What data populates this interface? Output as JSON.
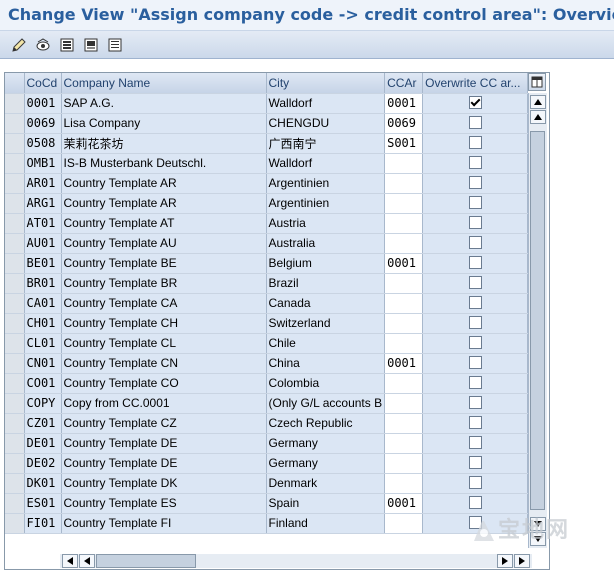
{
  "window": {
    "title": "Change View \"Assign company code -> credit control area\": Overview"
  },
  "toolbar": {
    "buttons": [
      "edit-icon",
      "display-change-icon",
      "select-all-icon",
      "select-block-icon",
      "deselect-all-icon"
    ]
  },
  "table": {
    "columns": [
      "CoCd",
      "Company Name",
      "City",
      "CCAr",
      "Overwrite CC ar..."
    ],
    "rows": [
      {
        "cocd": "0001",
        "name": "SAP A.G.",
        "city": "Walldorf",
        "ccar": "0001",
        "overwrite": true
      },
      {
        "cocd": "0069",
        "name": "Lisa Company",
        "city": "CHENGDU",
        "ccar": "0069",
        "overwrite": false
      },
      {
        "cocd": "0508",
        "name": "茉莉花茶坊",
        "city": "广西南宁",
        "ccar": "S001",
        "overwrite": false
      },
      {
        "cocd": "OMB1",
        "name": "IS-B Musterbank Deutschl.",
        "city": "Walldorf",
        "ccar": "",
        "overwrite": false
      },
      {
        "cocd": "AR01",
        "name": "Country Template AR",
        "city": "Argentinien",
        "ccar": "",
        "overwrite": false
      },
      {
        "cocd": "ARG1",
        "name": "Country Template AR",
        "city": "Argentinien",
        "ccar": "",
        "overwrite": false
      },
      {
        "cocd": "AT01",
        "name": "Country Template AT",
        "city": "Austria",
        "ccar": "",
        "overwrite": false
      },
      {
        "cocd": "AU01",
        "name": "Country Template AU",
        "city": "Australia",
        "ccar": "",
        "overwrite": false
      },
      {
        "cocd": "BE01",
        "name": "Country Template BE",
        "city": "Belgium",
        "ccar": "0001",
        "overwrite": false
      },
      {
        "cocd": "BR01",
        "name": "Country Template BR",
        "city": "Brazil",
        "ccar": "",
        "overwrite": false
      },
      {
        "cocd": "CA01",
        "name": "Country Template CA",
        "city": "Canada",
        "ccar": "",
        "overwrite": false
      },
      {
        "cocd": "CH01",
        "name": "Country Template CH",
        "city": "Switzerland",
        "ccar": "",
        "overwrite": false
      },
      {
        "cocd": "CL01",
        "name": "Country Template CL",
        "city": "Chile",
        "ccar": "",
        "overwrite": false
      },
      {
        "cocd": "CN01",
        "name": "Country Template CN",
        "city": "China",
        "ccar": "0001",
        "overwrite": false
      },
      {
        "cocd": "CO01",
        "name": "Country Template CO",
        "city": "Colombia",
        "ccar": "",
        "overwrite": false
      },
      {
        "cocd": "COPY",
        "name": "Copy from CC.0001",
        "city": "(Only G/L accounts B",
        "ccar": "",
        "overwrite": false
      },
      {
        "cocd": "CZ01",
        "name": "Country Template CZ",
        "city": "Czech Republic",
        "ccar": "",
        "overwrite": false
      },
      {
        "cocd": "DE01",
        "name": "Country Template DE",
        "city": "Germany",
        "ccar": "",
        "overwrite": false
      },
      {
        "cocd": "DE02",
        "name": "Country Template DE",
        "city": "Germany",
        "ccar": "",
        "overwrite": false
      },
      {
        "cocd": "DK01",
        "name": "Country Template DK",
        "city": "Denmark",
        "ccar": "",
        "overwrite": false
      },
      {
        "cocd": "ES01",
        "name": "Country Template ES",
        "city": "Spain",
        "ccar": "0001",
        "overwrite": false
      },
      {
        "cocd": "FI01",
        "name": "Country Template FI",
        "city": "Finland",
        "ccar": "",
        "overwrite": false
      }
    ]
  },
  "watermark": "宝地网"
}
